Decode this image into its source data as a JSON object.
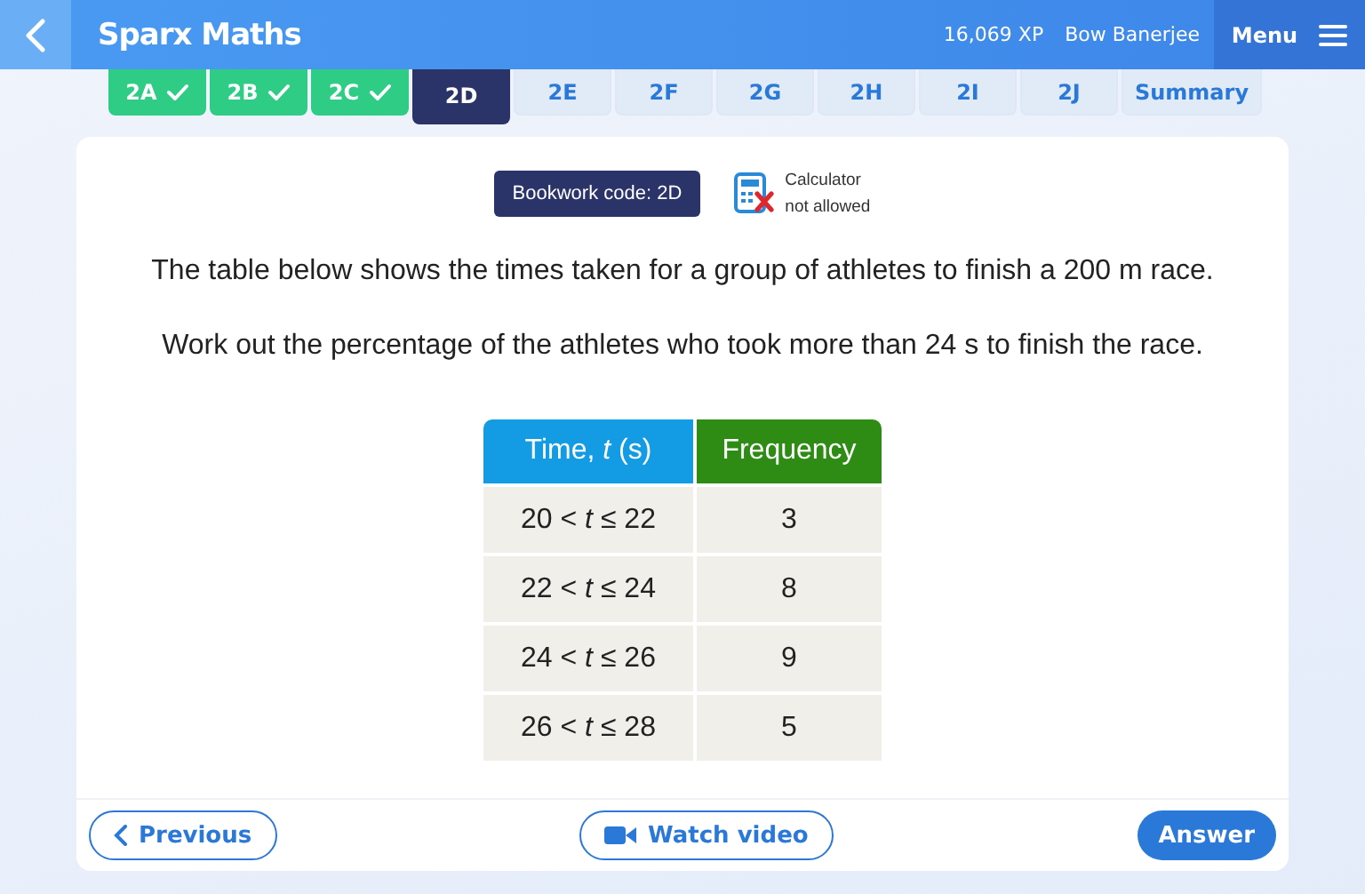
{
  "header": {
    "title": "Sparx Maths",
    "xp": "16,069 XP",
    "user": "Bow Banerjee",
    "menu": "Menu"
  },
  "tabs": [
    {
      "label": "2A",
      "done": true,
      "selected": false
    },
    {
      "label": "2B",
      "done": true,
      "selected": false
    },
    {
      "label": "2C",
      "done": true,
      "selected": false
    },
    {
      "label": "2D",
      "done": false,
      "selected": true
    },
    {
      "label": "2E",
      "done": false,
      "selected": false
    },
    {
      "label": "2F",
      "done": false,
      "selected": false
    },
    {
      "label": "2G",
      "done": false,
      "selected": false
    },
    {
      "label": "2H",
      "done": false,
      "selected": false
    },
    {
      "label": "2I",
      "done": false,
      "selected": false
    },
    {
      "label": "2J",
      "done": false,
      "selected": false
    },
    {
      "label": "Summary",
      "done": false,
      "selected": false
    }
  ],
  "bookwork_code": "Bookwork code: 2D",
  "calculator": {
    "allowed": false,
    "line_1": "Calculator",
    "line_2": "not allowed"
  },
  "question": [
    "The table below shows the times taken for a group of athletes to finish a 200 m race.",
    "Work out the percentage of the athletes who took more than 24 s to finish the race."
  ],
  "table": {
    "columns": [
      "Time, *t* (s)",
      "Frequency"
    ],
    "rows": [
      [
        "20 < *t* ≤ 22",
        "3"
      ],
      [
        "22 < *t* ≤ 24",
        "8"
      ],
      [
        "24 < *t* ≤ 26",
        "9"
      ],
      [
        "26 < *t* ≤ 28",
        "5"
      ]
    ]
  },
  "buttons": {
    "previous": "Previous",
    "video": "Watch video",
    "answer": "Answer"
  }
}
